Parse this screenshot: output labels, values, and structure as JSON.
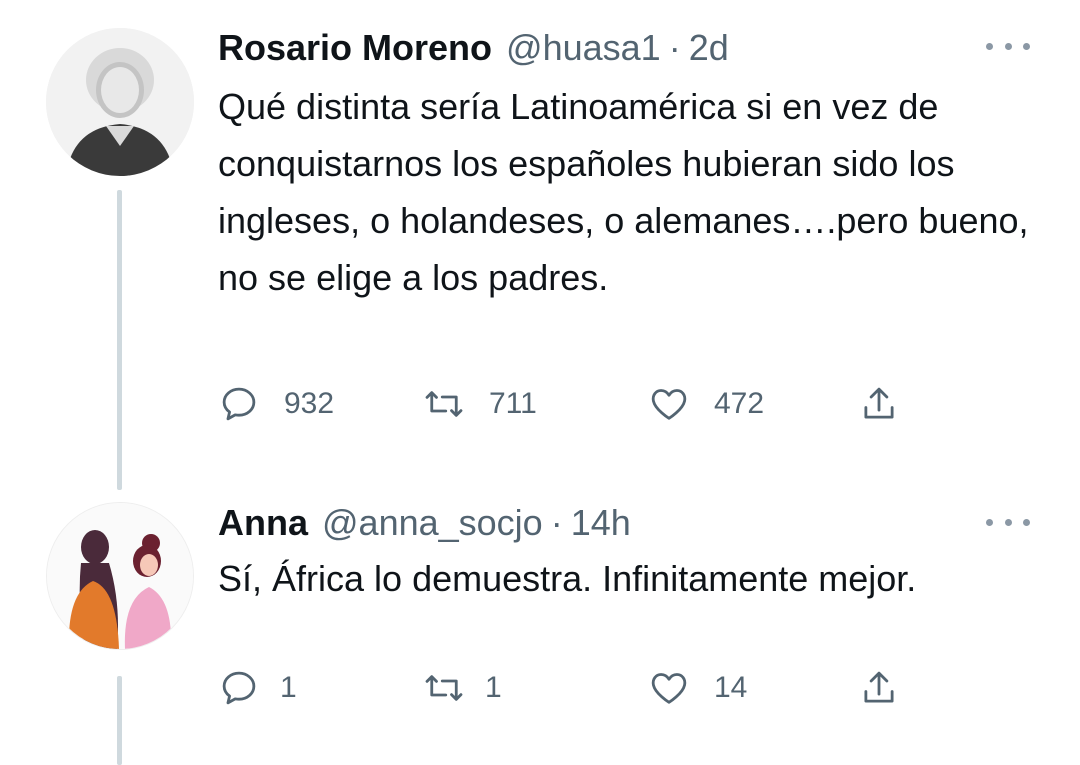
{
  "tweets": [
    {
      "author_name": "Rosario Moreno",
      "handle": "@huasa1",
      "separator": "·",
      "time": "2d",
      "text": "Qué distinta sería Latinoamérica si en vez de conquistarnos los españoles hubieran sido los ingleses, o holandeses, o alemanes….pero bueno, no se elige a los padres.",
      "replies": "932",
      "retweets": "711",
      "likes": "472"
    },
    {
      "author_name": "Anna",
      "handle": "@anna_socjo",
      "separator": "·",
      "time": "14h",
      "text": "Sí, África lo demuestra. Infinitamente mejor.",
      "replies": "1",
      "retweets": "1",
      "likes": "14"
    }
  ],
  "icons": {
    "reply": "comment-icon",
    "retweet": "retweet-icon",
    "like": "heart-icon",
    "share": "share-icon",
    "more": "more-horizontal-icon"
  },
  "colors": {
    "text_primary": "#0f1419",
    "text_secondary": "#536471",
    "thread_line": "#cfd9de"
  }
}
